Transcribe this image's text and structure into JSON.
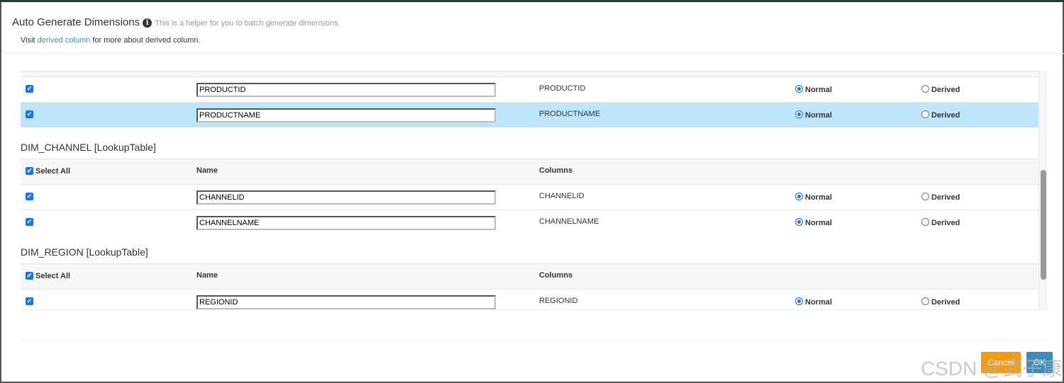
{
  "header": {
    "title": "Auto Generate Dimensions",
    "help": "This is a helper for you to batch generate dimensions.",
    "visit_prefix": "Visit",
    "link": "derived column",
    "visit_suffix": "for more about derived column."
  },
  "labels": {
    "select_all": "Select All",
    "name": "Name",
    "columns": "Columns",
    "normal": "Normal",
    "derived": "Derived"
  },
  "top_rows": [
    {
      "name": "PRODUCTID",
      "column": "PRODUCTID",
      "type": "Normal"
    },
    {
      "name": "PRODUCTNAME",
      "column": "PRODUCTNAME",
      "type": "Normal",
      "selected": true
    }
  ],
  "tables": [
    {
      "title": "DIM_CHANNEL [LookupTable]",
      "rows": [
        {
          "name": "CHANNELID",
          "column": "CHANNELID",
          "type": "Normal"
        },
        {
          "name": "CHANNELNAME",
          "column": "CHANNELNAME",
          "type": "Normal"
        }
      ]
    },
    {
      "title": "DIM_REGION [LookupTable]",
      "rows": [
        {
          "name": "REGIONID",
          "column": "REGIONID",
          "type": "Normal"
        }
      ]
    }
  ],
  "footer": {
    "cancel": "Cancel",
    "ok": "OK"
  },
  "watermark": "CSDN @武子康"
}
